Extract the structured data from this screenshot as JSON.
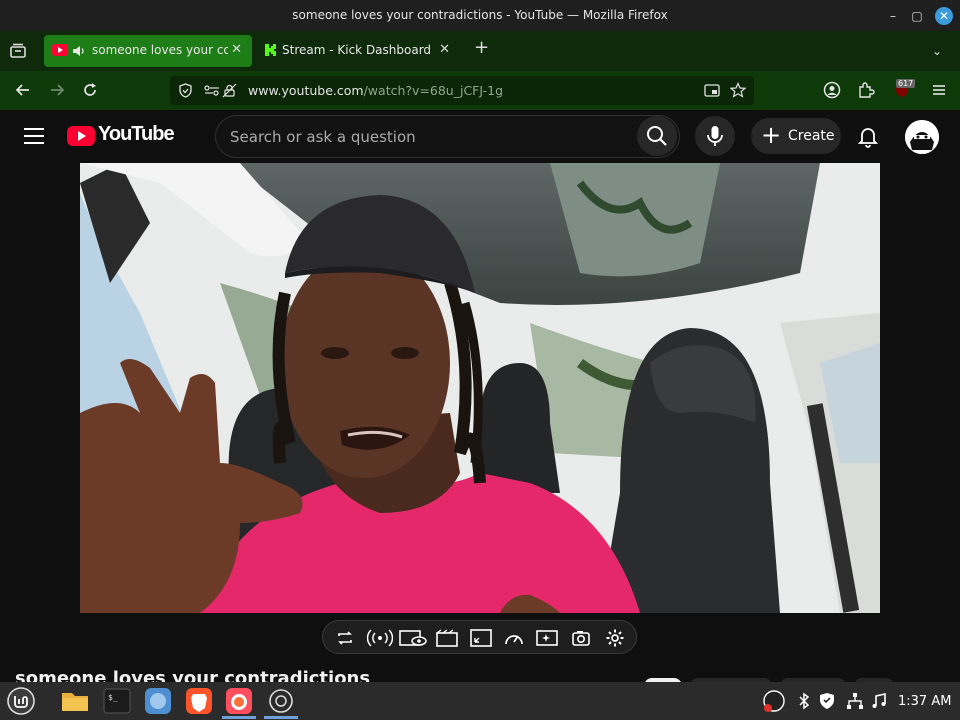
{
  "window": {
    "title": "someone loves your contradictions - YouTube — Mozilla Firefox"
  },
  "tabs": [
    {
      "label": "someone loves your contradictions",
      "active": true
    },
    {
      "label": "Stream - Kick Dashboard",
      "active": false
    }
  ],
  "urlbar": {
    "host": "www.youtube.com",
    "path": "/watch?v=68u_jCFJ-1g"
  },
  "extension": {
    "badge": "617"
  },
  "youtube": {
    "logo_text": "YouTube",
    "search_placeholder": "Search or ask a question",
    "create_label": "Create"
  },
  "video": {
    "title": "someone loves your contradictions"
  },
  "taskbar": {
    "clock": "1:37 AM"
  },
  "colors": {
    "tab_active": "#1e7d16",
    "tabstrip": "#0e2a0b",
    "navbar": "#0e3a0a",
    "yt_red": "#ff0033",
    "shirt": "#e5286a"
  }
}
